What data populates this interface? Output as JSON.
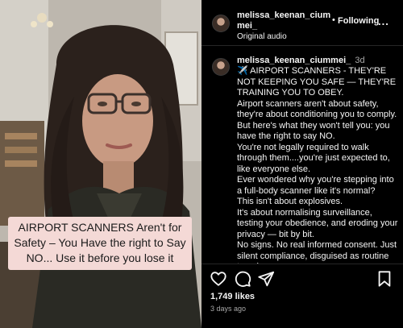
{
  "video": {
    "caption": "AIRPORT SCANNERS Aren't for Safety – You Have the right to Say NO... Use it before you lose it"
  },
  "header": {
    "username": "melissa_keenan_ciummei_",
    "separator": "•",
    "follow_label": "Following",
    "more_label": "...",
    "audio": "Original audio"
  },
  "comment": {
    "username": "melissa_keenan_ciummei_",
    "time": "3d",
    "lines": [
      "✈️ AIRPORT SCANNERS - THEY'RE NOT KEEPING YOU SAFE — THEY'RE TRAINING YOU TO OBEY.",
      "Airport scanners aren't about safety, they're about conditioning you to comply.",
      "But here's what they won't tell you: you have the right to say NO.",
      "You're not legally required to walk through them....you're just expected to, like everyone else.",
      "Ever wondered why you're stepping into a full-body scanner like it's normal?",
      "This isn't about explosives.",
      "It's about normalising surveillance, testing your obedience, and eroding your privacy — bit by bit.",
      "No signs. No real informed consent. Just silent compliance, disguised as routine travel."
    ]
  },
  "actions": {
    "like_icon": "heart-icon",
    "comment_icon": "comment-icon",
    "share_icon": "send-icon",
    "save_icon": "bookmark-icon"
  },
  "stats": {
    "likes": "1,749 likes",
    "ago": "3 days ago"
  }
}
